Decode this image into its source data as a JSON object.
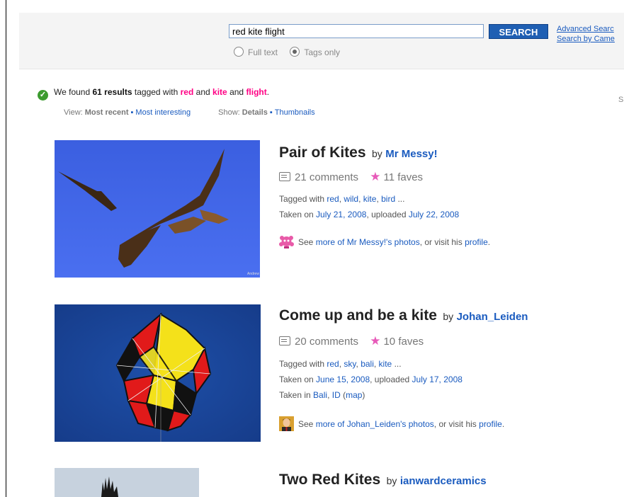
{
  "search": {
    "query": "red kite flight",
    "button_label": "SEARCH",
    "advanced_link": "Advanced Searc",
    "camera_link": "Search by Came",
    "option_fulltext": "Full text",
    "option_tags": "Tags only",
    "selected_option": "Tags only"
  },
  "summary": {
    "prefix": "We found",
    "count": "61 results",
    "tagged_with": "tagged with",
    "tag1": "red",
    "and1": "and",
    "tag2": "kite",
    "and2": "and",
    "tag3": "flight",
    "end": ".",
    "view_label": "View:",
    "view_current": "Most recent",
    "view_other": "Most interesting",
    "show_label": "Show:",
    "show_current": "Details",
    "show_other": "Thumbnails",
    "right_cut": "S"
  },
  "results": [
    {
      "title": "Pair of Kites",
      "by": "by",
      "owner": "Mr Messy!",
      "comments": "21 comments",
      "faves": "11 faves",
      "tagged_label": "Tagged with",
      "tags": [
        "red",
        "wild",
        "kite",
        "bird"
      ],
      "taken_label": "Taken on",
      "taken_date": "July 21, 2008",
      "uploaded_label": ", uploaded",
      "uploaded_date": "July 22, 2008",
      "see_more_prefix": "See",
      "see_more_link": "more of Mr Messy!'s photos",
      "visit_text": ", or visit his",
      "profile_link": "profile",
      "watermark": "Andrew"
    },
    {
      "title": "Come up and be a kite",
      "by": "by",
      "owner": "Johan_Leiden",
      "comments": "20 comments",
      "faves": "10 faves",
      "tagged_label": "Tagged with",
      "tags": [
        "red",
        "sky",
        "bali",
        "kite"
      ],
      "taken_label": "Taken on",
      "taken_date": "June 15, 2008",
      "uploaded_label": ", uploaded",
      "uploaded_date": "July 17, 2008",
      "location_label": "Taken in",
      "location_place": "Bali",
      "location_region": "ID",
      "map_link": "map",
      "see_more_prefix": "See",
      "see_more_link": "more of Johan_Leiden's photos",
      "visit_text": ", or visit his",
      "profile_link": "profile"
    },
    {
      "title": "Two Red Kites",
      "by": "by",
      "owner": "ianwardceramics"
    }
  ],
  "colors": {
    "link": "#1a5bbf",
    "tag_highlight": "#ff0084",
    "search_button": "#1f5fb3",
    "fave_star": "#e75ab9"
  }
}
